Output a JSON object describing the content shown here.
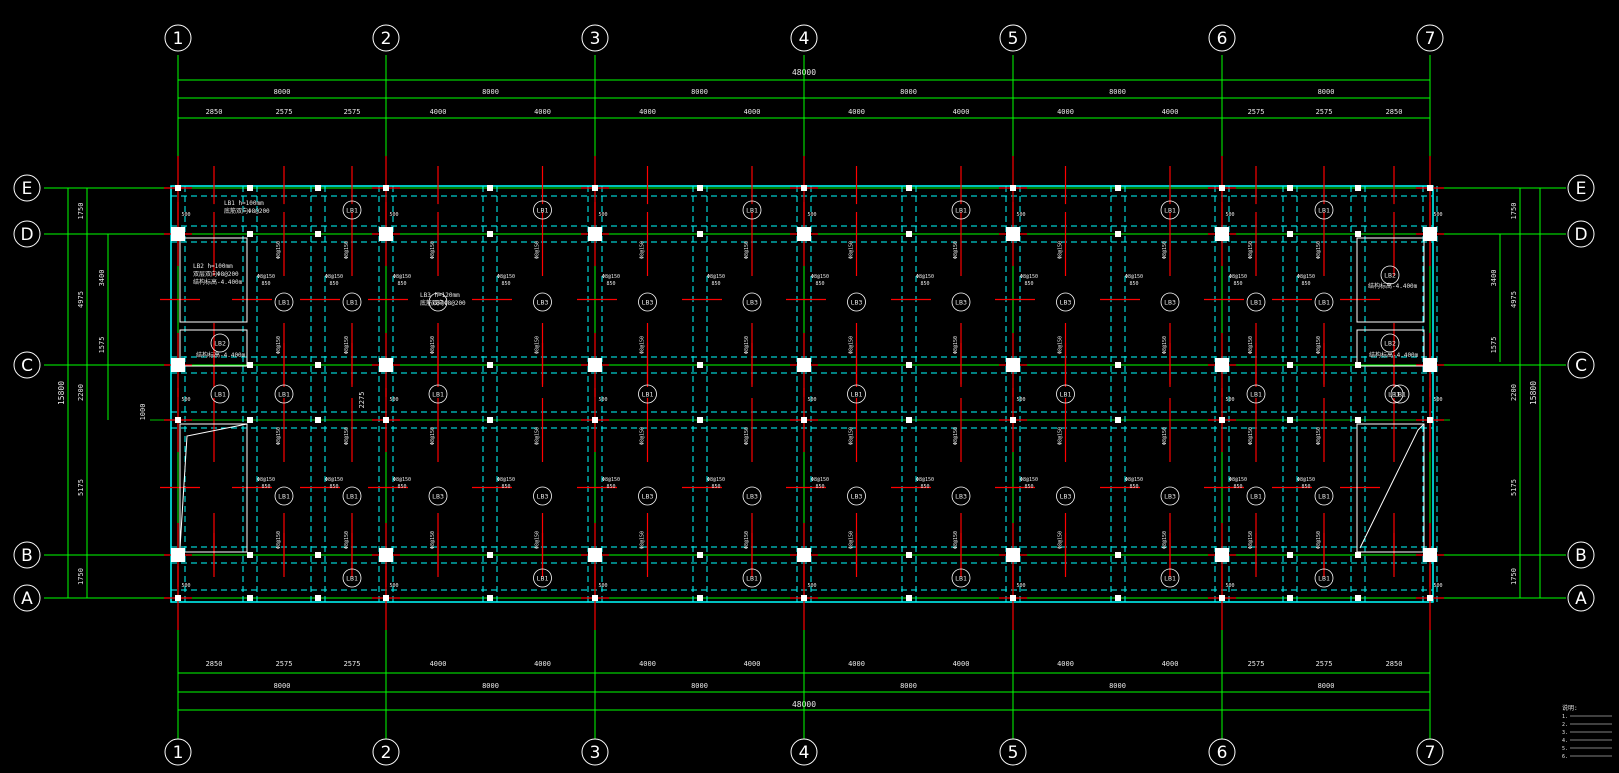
{
  "grid": {
    "columns": [
      "1",
      "2",
      "3",
      "4",
      "5",
      "6",
      "7"
    ],
    "rows": [
      "A",
      "B",
      "C",
      "D",
      "E"
    ]
  },
  "dims": {
    "overall_h": "48000",
    "bays_h": [
      "8000",
      "8000",
      "8000",
      "8000",
      "8000",
      "8000"
    ],
    "subbays_h": [
      "2850",
      "2575",
      "2575",
      "4000",
      "4000",
      "4000",
      "4000",
      "4000",
      "4000",
      "4000",
      "4000",
      "2575",
      "2575",
      "2850"
    ],
    "overall_v": "15800",
    "bays_v": [
      "1750",
      "5175",
      "2200",
      "4975",
      "1750"
    ],
    "left_detail": [
      "3400",
      "1575"
    ],
    "right_detail": [
      "3400",
      "1575"
    ],
    "corridor_detail": [
      "2275",
      "1000"
    ]
  },
  "slabs": {
    "lb1": "LB1",
    "lb2": "LB2",
    "lb3": "LB3",
    "note_lb1": "LB1 h=100mm",
    "note_lb1_rebar": "底筋双向Φ8@200",
    "note_lb2": "LB2 h=100mm",
    "note_lb2_rebar": "双层双向Φ8@200",
    "note_lb2_level": "结构标高-4.400m",
    "note_lb3": "LB3 h=120mm",
    "note_lb3_rebar": "底筋双向Φ8@200"
  },
  "rebar_labels": {
    "top": "Φ8@150",
    "len": "850",
    "sup": "500"
  },
  "notes": {
    "title": "说明:",
    "lines": [
      "1.",
      "2.",
      "3.",
      "4.",
      "5.",
      "6."
    ]
  },
  "colors": {
    "background": "#000000",
    "grid": "#00ff00",
    "beam": "#00ffff",
    "rebar": "#ff0000",
    "text": "#ffffff",
    "column": "#ffffff"
  }
}
